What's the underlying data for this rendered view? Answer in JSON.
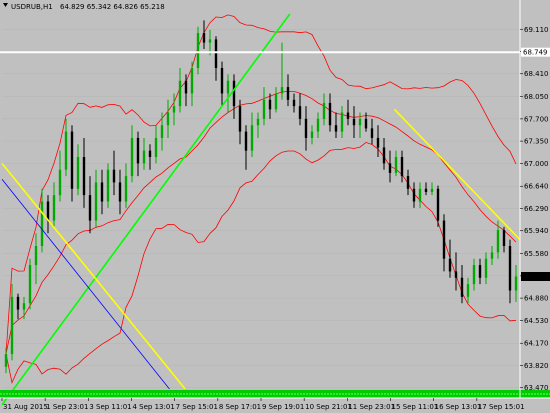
{
  "header": {
    "symbol": "USDRUB,H1",
    "ohlc": "64.829 65.342 64.826 65.218"
  },
  "price_axis": {
    "ticks": [
      "69.110",
      "68.760",
      "68.410",
      "68.050",
      "67.700",
      "67.350",
      "67.000",
      "66.640",
      "66.290",
      "65.940",
      "65.580",
      "65.230",
      "64.880",
      "64.530",
      "64.170",
      "63.820",
      "63.470"
    ],
    "hline_label": "68.749",
    "current_label": "65.218"
  },
  "time_axis": {
    "labels": [
      "31 Aug 2015",
      "1 Sep 23:01",
      "3 Sep 11:01",
      "4 Sep 13:01",
      "7 Sep 15:01",
      "8 Sep 17:01",
      "9 Sep 19:01",
      "10 Sep 21:01",
      "11 Sep 23:01",
      "15 Sep 11:01",
      "16 Sep 13:01",
      "17 Sep 15:01"
    ]
  },
  "colors": {
    "background": "#c0c0c0",
    "bull_candle": "#00aa00",
    "bear_candle": "#000000",
    "bollinger": "#ff0000",
    "trend_green": "#00ff00",
    "trend_yellow": "#ffff00",
    "trend_blue": "#0000ff",
    "hline": "#ffffff",
    "indicator_band": "#00cc00"
  },
  "chart_data": {
    "type": "candlestick",
    "symbol": "USDRUB",
    "timeframe": "H1",
    "ylim": [
      63.45,
      69.35
    ],
    "x_index_range": [
      0,
      99
    ],
    "horizontal_lines": [
      {
        "price": 68.749,
        "color": "#ffffff"
      }
    ],
    "trendlines": [
      {
        "color": "#00ff00",
        "from": [
          0,
          63.2
        ],
        "to": [
          55,
          69.35
        ]
      },
      {
        "color": "#ffff00",
        "from": [
          0,
          67.0
        ],
        "to": [
          35,
          63.45
        ]
      },
      {
        "color": "#ffff00",
        "from": [
          75,
          67.85
        ],
        "to": [
          99,
          65.8
        ]
      },
      {
        "color": "#0000ff",
        "from": [
          0,
          66.75
        ],
        "to": [
          32,
          63.45
        ]
      }
    ],
    "candles": [
      [
        63.8,
        64.1,
        63.7,
        64.0
      ],
      [
        64.0,
        65.1,
        63.9,
        64.9
      ],
      [
        64.9,
        64.95,
        64.55,
        64.7
      ],
      [
        64.7,
        64.9,
        64.55,
        64.8
      ],
      [
        64.8,
        65.5,
        64.7,
        65.4
      ],
      [
        65.4,
        65.9,
        65.1,
        65.7
      ],
      [
        65.7,
        66.6,
        65.6,
        66.4
      ],
      [
        66.4,
        66.5,
        65.9,
        66.1
      ],
      [
        66.1,
        66.7,
        66.0,
        66.5
      ],
      [
        66.5,
        67.2,
        66.4,
        66.9
      ],
      [
        66.9,
        67.7,
        66.8,
        67.5
      ],
      [
        67.5,
        67.6,
        66.4,
        66.6
      ],
      [
        66.6,
        67.3,
        66.5,
        67.1
      ],
      [
        67.1,
        67.4,
        66.3,
        66.5
      ],
      [
        66.5,
        66.8,
        65.9,
        66.1
      ],
      [
        66.1,
        66.9,
        66.0,
        66.7
      ],
      [
        66.7,
        66.9,
        66.2,
        66.4
      ],
      [
        66.4,
        67.0,
        66.3,
        66.9
      ],
      [
        66.9,
        67.2,
        66.5,
        66.7
      ],
      [
        66.7,
        66.9,
        66.2,
        66.4
      ],
      [
        66.4,
        67.0,
        66.3,
        66.8
      ],
      [
        66.8,
        67.6,
        66.7,
        67.4
      ],
      [
        67.4,
        67.5,
        66.8,
        67.0
      ],
      [
        67.0,
        67.4,
        66.9,
        67.2
      ],
      [
        67.2,
        67.3,
        66.9,
        67.1
      ],
      [
        67.1,
        67.6,
        67.0,
        67.4
      ],
      [
        67.4,
        67.8,
        67.2,
        67.6
      ],
      [
        67.6,
        68.0,
        67.4,
        67.8
      ],
      [
        67.8,
        68.1,
        67.6,
        67.9
      ],
      [
        67.9,
        68.5,
        67.8,
        68.3
      ],
      [
        68.3,
        68.4,
        67.9,
        68.1
      ],
      [
        68.1,
        68.6,
        67.9,
        68.5
      ],
      [
        68.5,
        69.15,
        68.4,
        69.05
      ],
      [
        69.05,
        69.25,
        68.8,
        68.9
      ],
      [
        68.9,
        69.1,
        68.7,
        68.95
      ],
      [
        68.95,
        69.0,
        68.3,
        68.5
      ],
      [
        68.5,
        68.6,
        67.9,
        68.1
      ],
      [
        68.1,
        68.4,
        67.8,
        68.3
      ],
      [
        68.3,
        68.4,
        67.7,
        67.9
      ],
      [
        67.9,
        68.0,
        67.3,
        67.5
      ],
      [
        67.5,
        67.6,
        66.9,
        67.2
      ],
      [
        67.2,
        67.8,
        67.1,
        67.6
      ],
      [
        67.6,
        67.8,
        67.4,
        67.7
      ],
      [
        67.7,
        68.2,
        67.6,
        68.0
      ],
      [
        68.0,
        68.1,
        67.7,
        67.85
      ],
      [
        67.85,
        68.2,
        67.8,
        68.1
      ],
      [
        68.1,
        68.9,
        68.0,
        68.2
      ],
      [
        68.2,
        68.4,
        67.9,
        68.0
      ],
      [
        68.0,
        68.1,
        67.8,
        67.9
      ],
      [
        67.9,
        68.1,
        67.6,
        67.7
      ],
      [
        67.7,
        67.9,
        67.2,
        67.4
      ],
      [
        67.4,
        67.6,
        67.3,
        67.5
      ],
      [
        67.5,
        67.8,
        67.4,
        67.7
      ],
      [
        67.7,
        68.1,
        67.6,
        67.95
      ],
      [
        67.95,
        68.1,
        67.5,
        67.6
      ],
      [
        67.6,
        67.8,
        67.4,
        67.5
      ],
      [
        67.5,
        67.9,
        67.4,
        67.8
      ],
      [
        67.8,
        68.0,
        67.6,
        67.7
      ],
      [
        67.7,
        67.9,
        67.4,
        67.6
      ],
      [
        67.6,
        67.8,
        67.4,
        67.7
      ],
      [
        67.7,
        67.8,
        67.5,
        67.55
      ],
      [
        67.55,
        67.7,
        67.3,
        67.4
      ],
      [
        67.4,
        67.6,
        67.1,
        67.25
      ],
      [
        67.25,
        67.4,
        66.9,
        67.0
      ],
      [
        67.0,
        67.2,
        66.7,
        66.85
      ],
      [
        66.85,
        67.2,
        66.8,
        67.1
      ],
      [
        67.1,
        67.2,
        66.7,
        66.8
      ],
      [
        66.8,
        66.9,
        66.5,
        66.6
      ],
      [
        66.6,
        66.7,
        66.3,
        66.4
      ],
      [
        66.4,
        66.7,
        66.3,
        66.6
      ],
      [
        66.6,
        66.7,
        66.5,
        66.55
      ],
      [
        66.55,
        66.7,
        66.5,
        66.6
      ],
      [
        66.6,
        66.65,
        66.0,
        66.1
      ],
      [
        66.1,
        66.2,
        65.3,
        65.5
      ],
      [
        65.5,
        65.8,
        65.2,
        65.3
      ],
      [
        65.3,
        65.6,
        65.0,
        65.2
      ],
      [
        65.2,
        65.4,
        64.8,
        64.9
      ],
      [
        64.9,
        65.2,
        64.8,
        65.1
      ],
      [
        65.1,
        65.5,
        65.0,
        65.4
      ],
      [
        65.4,
        65.5,
        65.1,
        65.2
      ],
      [
        65.2,
        65.6,
        65.1,
        65.5
      ],
      [
        65.5,
        65.7,
        65.4,
        65.6
      ],
      [
        65.6,
        66.1,
        65.5,
        65.95
      ],
      [
        65.95,
        66.0,
        65.6,
        65.7
      ],
      [
        65.7,
        65.8,
        64.8,
        65.0
      ],
      [
        65.0,
        65.4,
        64.82,
        65.22
      ]
    ]
  }
}
